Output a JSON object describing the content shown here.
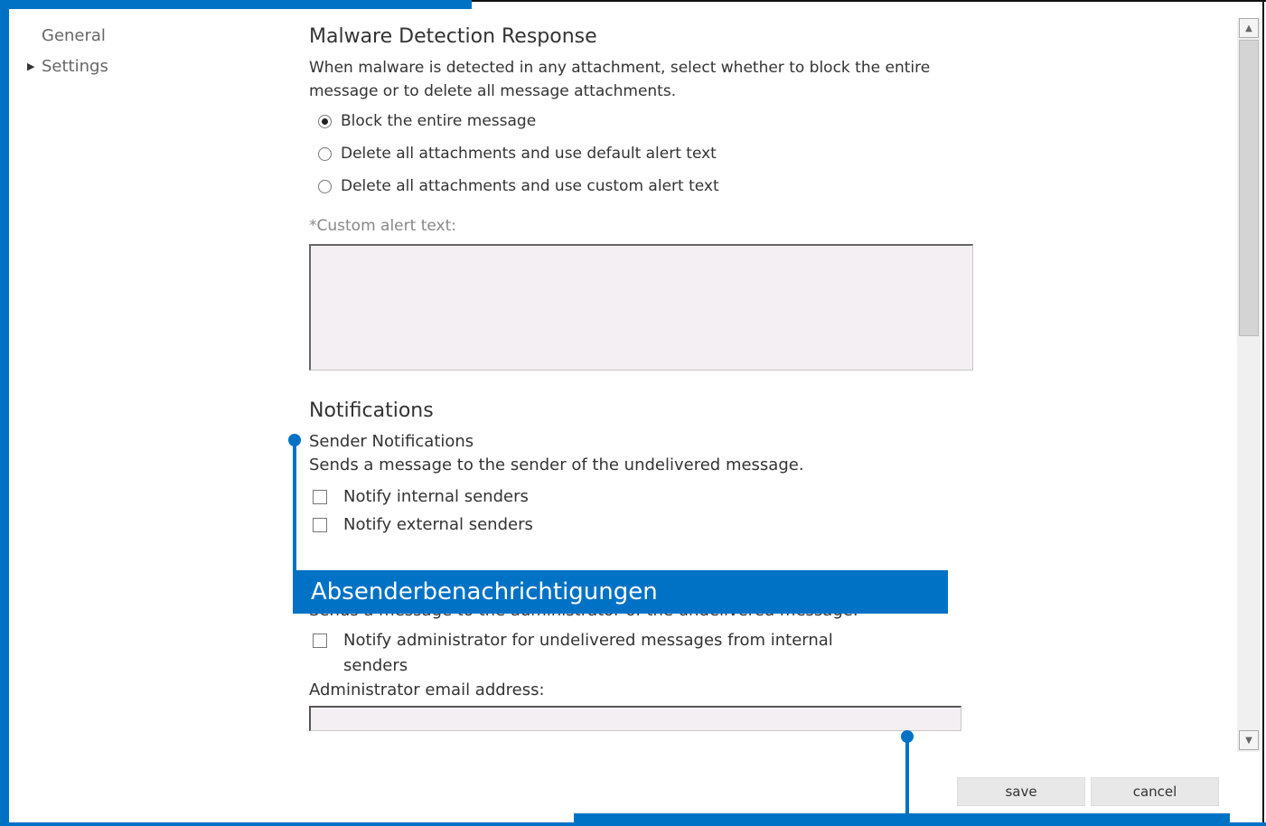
{
  "nav": {
    "items": [
      {
        "label": "General"
      },
      {
        "label": "Settings"
      }
    ]
  },
  "malware": {
    "title": "Malware Detection Response",
    "description": "When malware is detected in any attachment, select whether to block the entire message or to delete all message attachments.",
    "options": [
      {
        "label": "Block the entire message",
        "selected": true
      },
      {
        "label": "Delete all attachments and use default alert text",
        "selected": false
      },
      {
        "label": "Delete all attachments and use custom alert text",
        "selected": false
      }
    ],
    "custom_alert_label": "*Custom alert text:",
    "custom_alert_value": ""
  },
  "notifications": {
    "title": "Notifications",
    "sender_title": "Sender Notifications",
    "sender_description": "Sends a message to the sender of the undelivered message.",
    "notify_internal": "Notify internal senders",
    "notify_external": "Notify external senders",
    "admin_description": "Sends a message to the administrator of the undelivered message.",
    "notify_admin_internal": "Notify administrator for undelivered messages from internal senders",
    "admin_email_label": "Administrator email address:",
    "admin_email_value": ""
  },
  "callouts": {
    "sender": "Absenderbenachrichtigungen",
    "admin": ""
  },
  "buttons": {
    "save": "save",
    "cancel": "cancel"
  },
  "colors": {
    "accent": "#0072c6",
    "field_bg": "#f3eff2"
  }
}
